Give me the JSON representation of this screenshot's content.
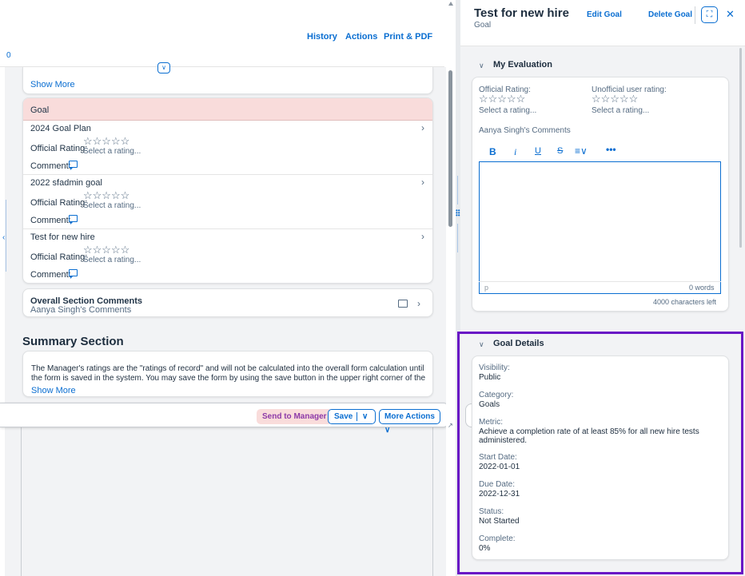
{
  "top_bar": {
    "history": "History",
    "actions": "Actions",
    "print": "Print & PDF",
    "counter": "0"
  },
  "show_more": "Show More",
  "goal_section": {
    "header": "Goal",
    "official_rating_label": "Official Rating:",
    "select_rating": "Select a rating...",
    "comment_label": "Comment:",
    "goals": [
      {
        "title": "2024 Goal Plan"
      },
      {
        "title": "2022 sfadmin goal"
      },
      {
        "title": "Test for new hire"
      }
    ]
  },
  "overall_section": {
    "title": "Overall Section Comments",
    "subtitle": "Aanya Singh's Comments"
  },
  "summary_section": {
    "title": "Summary Section",
    "text": "The Manager's ratings are the \"ratings of record\" and will not be calculated into the overall form calculation until the form is saved in the system. You may save the form by using the save button in the upper right corner of the form to view the total score, or save at",
    "show_more": "Show More"
  },
  "footer": {
    "send_to_manager": "Send to Manager",
    "save": "Save",
    "more_actions": "More Actions"
  },
  "right_panel": {
    "title": "Test for new hire",
    "subtitle": "Goal",
    "edit_goal": "Edit Goal",
    "delete_goal": "Delete Goal",
    "my_evaluation": {
      "heading": "My Evaluation",
      "official_rating_label": "Official Rating:",
      "unofficial_rating_label": "Unofficial user rating:",
      "select_rating": "Select a rating...",
      "comments_label": "Aanya Singh's Comments",
      "toolbar": {
        "bold": "B",
        "italic": "i",
        "underline": "U",
        "strike": "S"
      },
      "editor_tag": "p",
      "word_count": "0 words",
      "chars_left": "4000 characters left"
    },
    "goal_details": {
      "heading": "Goal Details",
      "fields": [
        {
          "label": "Visibility:",
          "value": "Public"
        },
        {
          "label": "Category:",
          "value": "Goals"
        },
        {
          "label": "Metric:",
          "value": "Achieve a completion rate of at least 85% for all new hire tests administered."
        },
        {
          "label": "Start Date:",
          "value": "2022-01-01"
        },
        {
          "label": "Due Date:",
          "value": "2022-12-31"
        },
        {
          "label": "Status:",
          "value": "Not Started"
        },
        {
          "label": "Complete:",
          "value": "0%"
        }
      ]
    }
  },
  "colors": {
    "accent": "#0a6ed1",
    "goal_header_bg": "#f9dcdb",
    "send_button_text": "#8d3aa8",
    "highlight_frame": "#6915c5",
    "page_bg": "#f2f3f5"
  }
}
